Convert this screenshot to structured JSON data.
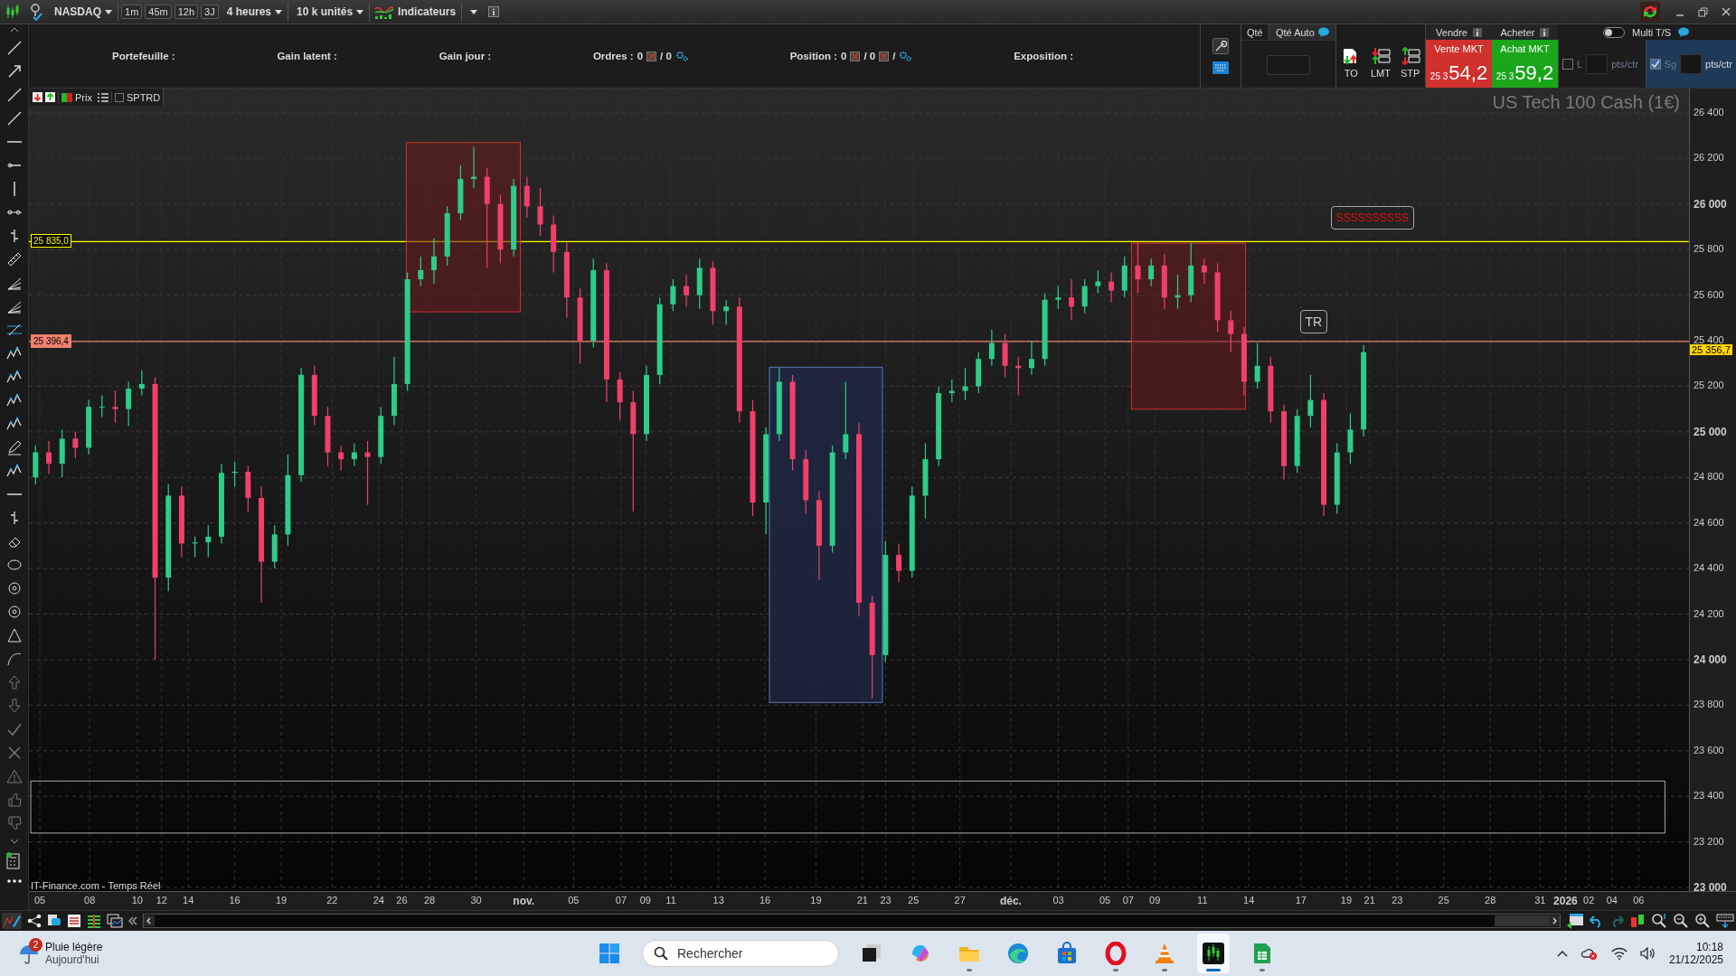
{
  "toolbar": {
    "instrument": "NASDAQ",
    "intervals": [
      {
        "label": "1m"
      },
      {
        "label": "45m"
      },
      {
        "label": "12h"
      },
      {
        "label": "3J"
      }
    ],
    "period": "4 heures",
    "units": "10 k unités",
    "indicators": "Indicateurs"
  },
  "account": [
    {
      "label": "Portefeuille :"
    },
    {
      "label": "Gain latent :"
    },
    {
      "label": "Gain jour :"
    },
    {
      "label": "Ordres :",
      "parts": [
        {
          "kind": "text",
          "text": "0"
        },
        {
          "kind": "cancel"
        },
        {
          "kind": "text",
          "text": "/ 0"
        },
        {
          "kind": "gear"
        }
      ]
    },
    {
      "label": "Position :",
      "parts": [
        {
          "kind": "text",
          "text": "0"
        },
        {
          "kind": "cancel"
        },
        {
          "kind": "text",
          "text": "/ 0"
        },
        {
          "kind": "cancel"
        },
        {
          "kind": "text",
          "text": "/"
        },
        {
          "kind": "gear"
        }
      ]
    },
    {
      "label": "Exposition :"
    }
  ],
  "order_panel": {
    "qty_label": "Qté",
    "qty_auto": "Qté Auto",
    "order_types": [
      {
        "kind": "to",
        "label": "TO"
      },
      {
        "kind": "lmt",
        "label": "LMT"
      },
      {
        "kind": "stp",
        "label": "STP"
      }
    ],
    "sell": {
      "header": "Vendre",
      "button": "Vente MKT",
      "price_prefix": "25 3",
      "price": "54,2"
    },
    "buy": {
      "header": "Acheter",
      "button": "Achat MKT",
      "price_prefix": "25 3",
      "price": "59,2"
    },
    "multi_ts": {
      "label": "Multi T/S",
      "on": false
    },
    "limit": {
      "label": "L",
      "checked": false,
      "unit": "pts/ctr"
    },
    "stop": {
      "label": "Sg",
      "checked": true,
      "unit": "pts/ctr"
    }
  },
  "chart": {
    "toolbar": {
      "price_label": "Prix",
      "sptrd": {
        "label": "SPTRD",
        "checked": false
      }
    },
    "title": "US Tech 100 Cash (1€)",
    "last_price": "25 356,7",
    "notes": [
      {
        "text": "SSSSSSSSSS",
        "kind": "alert"
      },
      {
        "text": "TR",
        "kind": "plain"
      }
    ],
    "xticks": [
      {
        "label": "05",
        "major": false
      },
      {
        "label": "08",
        "major": false
      },
      {
        "label": "10",
        "major": false
      },
      {
        "label": "12",
        "major": false
      },
      {
        "label": "14",
        "major": false
      },
      {
        "label": "16",
        "major": false
      },
      {
        "label": "19",
        "major": false
      },
      {
        "label": "22",
        "major": false
      },
      {
        "label": "24",
        "major": false
      },
      {
        "label": "26",
        "major": false
      },
      {
        "label": "28",
        "major": false
      },
      {
        "label": "30",
        "major": false
      },
      {
        "label": "nov.",
        "major": true
      },
      {
        "label": "05",
        "major": false
      },
      {
        "label": "07",
        "major": false
      },
      {
        "label": "09",
        "major": false
      },
      {
        "label": "11",
        "major": false
      },
      {
        "label": "13",
        "major": false
      },
      {
        "label": "16",
        "major": false
      },
      {
        "label": "19",
        "major": false
      },
      {
        "label": "21",
        "major": false
      },
      {
        "label": "23",
        "major": false
      },
      {
        "label": "25",
        "major": false
      },
      {
        "label": "27",
        "major": false
      },
      {
        "label": "déc.",
        "major": true
      },
      {
        "label": "03",
        "major": false
      },
      {
        "label": "05",
        "major": false
      },
      {
        "label": "07",
        "major": false
      },
      {
        "label": "09",
        "major": false
      },
      {
        "label": "11",
        "major": false
      },
      {
        "label": "14",
        "major": false
      },
      {
        "label": "17",
        "major": false
      },
      {
        "label": "19",
        "major": false
      },
      {
        "label": "21",
        "major": false
      },
      {
        "label": "23",
        "major": false
      },
      {
        "label": "25",
        "major": false
      },
      {
        "label": "28",
        "major": false
      },
      {
        "label": "31",
        "major": false
      },
      {
        "label": "2026",
        "major": true
      },
      {
        "label": "02",
        "major": false
      },
      {
        "label": "04",
        "major": false
      },
      {
        "label": "06",
        "major": false
      }
    ],
    "chart_data": {
      "type": "candlestick",
      "ylim": [
        23000,
        26400
      ],
      "grid": true,
      "ref_lines": [
        {
          "axis": "y",
          "value": 25835,
          "label": "25 835,0",
          "color": "#ffff00"
        },
        {
          "axis": "y",
          "value": 25396.4,
          "label": "25 396,4",
          "color": "#f08070"
        }
      ],
      "yticks": [
        {
          "value": 26400,
          "label": "26 400"
        },
        {
          "value": 26200,
          "label": "26 200"
        },
        {
          "value": 26000,
          "label": "26 000"
        },
        {
          "value": 25800,
          "label": "25 800"
        },
        {
          "value": 25600,
          "label": "25 600"
        },
        {
          "value": 25400,
          "label": "25 400"
        },
        {
          "value": 25200,
          "label": "25 200"
        },
        {
          "value": 25000,
          "label": "25 000"
        },
        {
          "value": 24800,
          "label": "24 800"
        },
        {
          "value": 24600,
          "label": "24 600"
        },
        {
          "value": 24400,
          "label": "24 400"
        },
        {
          "value": 24200,
          "label": "24 200"
        },
        {
          "value": 24000,
          "label": "24 000"
        },
        {
          "value": 23800,
          "label": "23 800"
        },
        {
          "value": 23600,
          "label": "23 600"
        },
        {
          "value": 23400,
          "label": "23 400"
        },
        {
          "value": 23200,
          "label": "23 200"
        },
        {
          "value": 23000,
          "label": "23 000"
        }
      ],
      "categories": [
        null,
        null,
        null,
        null,
        null,
        null,
        null,
        null,
        null,
        null,
        null,
        null,
        null,
        null,
        null,
        null,
        null,
        null,
        null,
        null,
        null,
        null,
        null,
        null,
        null,
        null,
        null,
        null,
        null,
        null,
        null,
        null,
        null,
        null,
        null,
        null,
        null,
        null,
        null,
        null,
        null,
        null,
        null,
        null,
        null,
        null,
        null,
        null,
        null,
        null,
        null,
        null,
        null,
        null,
        null,
        null,
        null,
        null,
        null,
        null,
        null,
        null,
        null,
        null,
        null,
        null,
        null,
        null,
        null,
        null,
        null,
        null,
        null,
        null,
        null,
        null,
        null,
        null,
        null,
        null,
        null,
        null,
        null,
        null,
        null,
        null,
        null,
        null,
        null,
        null,
        null,
        null,
        null,
        null,
        null,
        null,
        null,
        null,
        null,
        null,
        null,
        null,
        null,
        null,
        null,
        null,
        null,
        null,
        null,
        null,
        null,
        null,
        null,
        null,
        null,
        null,
        null,
        null,
        null,
        null,
        null,
        null,
        null,
        null,
        null
      ],
      "ohlc": [
        [
          24800,
          24940,
          24770,
          24910
        ],
        [
          24910,
          24960,
          24815,
          24860
        ],
        [
          24860,
          25010,
          24800,
          24970
        ],
        [
          24970,
          25000,
          24885,
          24930
        ],
        [
          24930,
          25140,
          24900,
          25110
        ],
        [
          25110,
          25160,
          25065,
          25110
        ],
        [
          25110,
          25180,
          25040,
          25100
        ],
        [
          25100,
          25220,
          25025,
          25190
        ],
        [
          25190,
          25270,
          25160,
          25210
        ],
        [
          25210,
          25240,
          24000,
          24360
        ],
        [
          24360,
          24770,
          24300,
          24720
        ],
        [
          24720,
          24760,
          24450,
          24510
        ],
        [
          24510,
          24540,
          24450,
          24515
        ],
        [
          24515,
          24590,
          24450,
          24540
        ],
        [
          24540,
          24860,
          24510,
          24820
        ],
        [
          24820,
          24870,
          24760,
          24825
        ],
        [
          24825,
          24850,
          24650,
          24710
        ],
        [
          24710,
          24760,
          24250,
          24430
        ],
        [
          24430,
          24590,
          24400,
          24550
        ],
        [
          24550,
          24900,
          24500,
          24810
        ],
        [
          24810,
          25280,
          24780,
          25250
        ],
        [
          25250,
          25290,
          25030,
          25070
        ],
        [
          25070,
          25110,
          24850,
          24910
        ],
        [
          24910,
          24940,
          24830,
          24880
        ],
        [
          24880,
          24950,
          24850,
          24910
        ],
        [
          24910,
          24960,
          24680,
          24890
        ],
        [
          24890,
          25110,
          24860,
          25070
        ],
        [
          25070,
          25330,
          25030,
          25210
        ],
        [
          25210,
          25700,
          25180,
          25670
        ],
        [
          25670,
          25770,
          25640,
          25710
        ],
        [
          25710,
          25850,
          25650,
          25770
        ],
        [
          25770,
          25990,
          25730,
          25960
        ],
        [
          25960,
          26170,
          25930,
          26110
        ],
        [
          26110,
          26250,
          26070,
          26120
        ],
        [
          26120,
          26160,
          25720,
          26000
        ],
        [
          26000,
          26040,
          25740,
          25800
        ],
        [
          25800,
          26110,
          25770,
          26080
        ],
        [
          26080,
          26120,
          25940,
          25990
        ],
        [
          25990,
          26070,
          25860,
          25910
        ],
        [
          25910,
          25950,
          25700,
          25790
        ],
        [
          25790,
          25830,
          25500,
          25590
        ],
        [
          25590,
          25630,
          25300,
          25400
        ],
        [
          25400,
          25760,
          25370,
          25710
        ],
        [
          25710,
          25740,
          25130,
          25230
        ],
        [
          25230,
          25260,
          25050,
          25130
        ],
        [
          25130,
          25180,
          24650,
          24990
        ],
        [
          24990,
          25290,
          24960,
          25250
        ],
        [
          25250,
          25590,
          25210,
          25560
        ],
        [
          25560,
          25670,
          25530,
          25640
        ],
        [
          25640,
          25690,
          25550,
          25600
        ],
        [
          25600,
          25760,
          25540,
          25720
        ],
        [
          25720,
          25750,
          25470,
          25530
        ],
        [
          25530,
          25580,
          25470,
          25550
        ],
        [
          25550,
          25590,
          25040,
          25090
        ],
        [
          25090,
          25140,
          24630,
          24690
        ],
        [
          24690,
          25020,
          24550,
          24990
        ],
        [
          24990,
          25280,
          24960,
          25220
        ],
        [
          25220,
          25250,
          24830,
          24880
        ],
        [
          24880,
          24920,
          24640,
          24700
        ],
        [
          24700,
          24740,
          24350,
          24500
        ],
        [
          24500,
          24940,
          24470,
          24910
        ],
        [
          24910,
          25220,
          24880,
          24990
        ],
        [
          24990,
          25040,
          24190,
          24250
        ],
        [
          24250,
          24280,
          23830,
          24020
        ],
        [
          24020,
          24520,
          23990,
          24460
        ],
        [
          24460,
          24510,
          24340,
          24390
        ],
        [
          24390,
          24760,
          24360,
          24720
        ],
        [
          24720,
          24950,
          24620,
          24880
        ],
        [
          24880,
          25200,
          24850,
          25170
        ],
        [
          25170,
          25230,
          25130,
          25180
        ],
        [
          25180,
          25280,
          25140,
          25200
        ],
        [
          25200,
          25350,
          25170,
          25320
        ],
        [
          25320,
          25450,
          25290,
          25390
        ],
        [
          25390,
          25430,
          25240,
          25290
        ],
        [
          25290,
          25330,
          25160,
          25280
        ],
        [
          25280,
          25400,
          25250,
          25320
        ],
        [
          25320,
          25610,
          25290,
          25580
        ],
        [
          25580,
          25640,
          25540,
          25590
        ],
        [
          25590,
          25670,
          25490,
          25550
        ],
        [
          25550,
          25670,
          25520,
          25640
        ],
        [
          25640,
          25710,
          25610,
          25660
        ],
        [
          25660,
          25700,
          25570,
          25620
        ],
        [
          25620,
          25770,
          25590,
          25730
        ],
        [
          25730,
          25830,
          25610,
          25670
        ],
        [
          25670,
          25760,
          25640,
          25730
        ],
        [
          25730,
          25780,
          25540,
          25590
        ],
        [
          25590,
          25690,
          25540,
          25600
        ],
        [
          25600,
          25830,
          25570,
          25730
        ],
        [
          25730,
          25760,
          25650,
          25700
        ],
        [
          25700,
          25740,
          25440,
          25490
        ],
        [
          25490,
          25530,
          25350,
          25430
        ],
        [
          25430,
          25460,
          25160,
          25220
        ],
        [
          25220,
          25390,
          25190,
          25290
        ],
        [
          25290,
          25330,
          25040,
          25090
        ],
        [
          25090,
          25120,
          24790,
          24850
        ],
        [
          24850,
          25100,
          24820,
          25070
        ],
        [
          25070,
          25250,
          25020,
          25140
        ],
        [
          25140,
          25170,
          24630,
          24680
        ],
        [
          24680,
          24950,
          24640,
          24910
        ],
        [
          24910,
          25080,
          24860,
          25010
        ],
        [
          25010,
          25380,
          24980,
          25350
        ],
        null,
        null,
        null,
        null,
        null,
        null,
        null,
        null,
        null,
        null,
        null,
        null,
        null,
        null,
        null,
        null,
        null,
        null,
        null,
        null,
        null,
        null,
        null,
        null
      ]
    },
    "source": "IT-Finance.com - Temps Réel"
  },
  "taskbar": {
    "weather": {
      "badge": "2",
      "title": "Pluie légère",
      "subtitle": "Aujourd'hui"
    },
    "search_placeholder": "Rechercher",
    "apps": [
      {
        "kind": "start",
        "running": false,
        "selected": false
      },
      {
        "kind": "taskview",
        "running": false,
        "selected": false
      },
      {
        "kind": "swirl",
        "running": false,
        "selected": false
      },
      {
        "kind": "folder",
        "running": true,
        "selected": false
      },
      {
        "kind": "wave",
        "running": false,
        "selected": false
      },
      {
        "kind": "store",
        "running": false,
        "selected": false
      },
      {
        "kind": "ring",
        "running": true,
        "selected": false
      },
      {
        "kind": "cone",
        "running": true,
        "selected": false
      },
      {
        "kind": "candles",
        "running": true,
        "selected": true
      },
      {
        "kind": "sheet",
        "running": true,
        "selected": false
      }
    ],
    "time": "10:18",
    "date": "21/12/2025"
  }
}
